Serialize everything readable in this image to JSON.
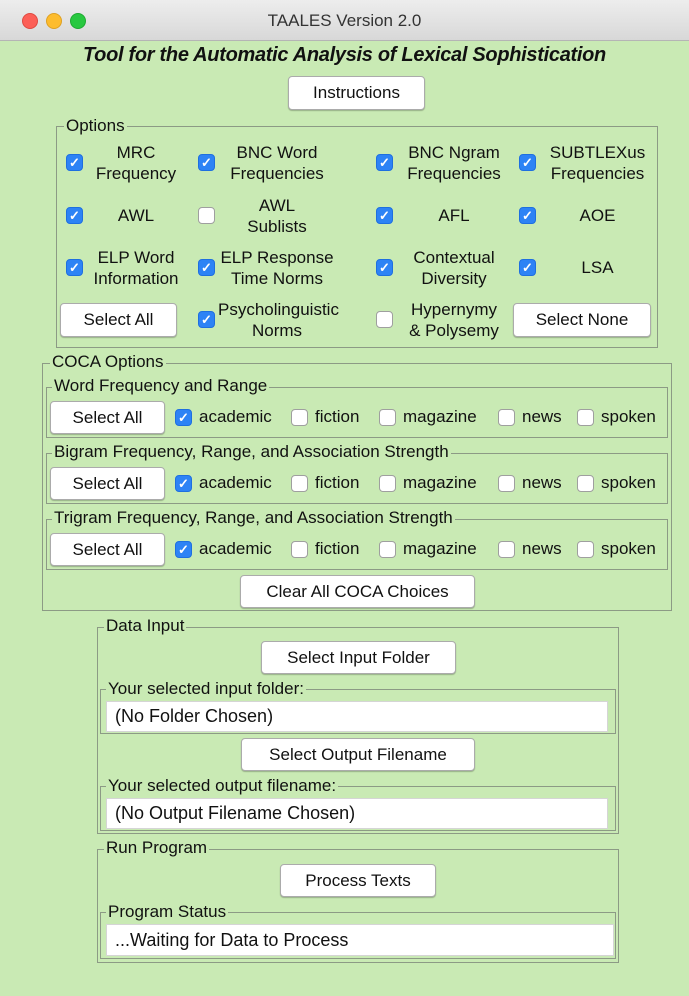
{
  "window": {
    "title": "TAALES Version 2.0"
  },
  "app_title": "Tool for the Automatic Analysis of Lexical Sophistication",
  "instructions_label": "Instructions",
  "options": {
    "legend": "Options",
    "items": [
      {
        "line1": "MRC",
        "line2": "Frequency",
        "checked": true
      },
      {
        "line1": "BNC Word",
        "line2": "Frequencies",
        "checked": true
      },
      {
        "line1": "BNC Ngram",
        "line2": "Frequencies",
        "checked": true
      },
      {
        "line1": "SUBTLEXus",
        "line2": "Frequencies",
        "checked": true
      },
      {
        "line1": "AWL",
        "line2": "",
        "checked": true
      },
      {
        "line1": "AWL",
        "line2": "Sublists",
        "checked": false
      },
      {
        "line1": "AFL",
        "line2": "",
        "checked": true
      },
      {
        "line1": "AOE",
        "line2": "",
        "checked": true
      },
      {
        "line1": "ELP Word",
        "line2": "Information",
        "checked": true
      },
      {
        "line1": "ELP Response",
        "line2": "Time Norms",
        "checked": true
      },
      {
        "line1": "Contextual",
        "line2": "Diversity",
        "checked": true
      },
      {
        "line1": "LSA",
        "line2": "",
        "checked": true
      },
      {
        "line1": "Psycholinguistic",
        "line2": "Norms",
        "checked": true
      },
      {
        "line1": "Hypernymy",
        "line2": "& Polysemy",
        "checked": false
      }
    ],
    "select_all_label": "Select All",
    "select_none_label": "Select None"
  },
  "coca": {
    "legend": "COCA Options",
    "groups": [
      {
        "legend": "Word Frequency and Range",
        "select_all_label": "Select All",
        "choices": [
          {
            "label": "academic",
            "checked": true
          },
          {
            "label": "fiction",
            "checked": false
          },
          {
            "label": "magazine",
            "checked": false
          },
          {
            "label": "news",
            "checked": false
          },
          {
            "label": "spoken",
            "checked": false
          }
        ]
      },
      {
        "legend": "Bigram Frequency, Range, and Association Strength",
        "select_all_label": "Select All",
        "choices": [
          {
            "label": "academic",
            "checked": true
          },
          {
            "label": "fiction",
            "checked": false
          },
          {
            "label": "magazine",
            "checked": false
          },
          {
            "label": "news",
            "checked": false
          },
          {
            "label": "spoken",
            "checked": false
          }
        ]
      },
      {
        "legend": "Trigram Frequency, Range, and Association Strength",
        "select_all_label": "Select All",
        "choices": [
          {
            "label": "academic",
            "checked": true
          },
          {
            "label": "fiction",
            "checked": false
          },
          {
            "label": "magazine",
            "checked": false
          },
          {
            "label": "news",
            "checked": false
          },
          {
            "label": "spoken",
            "checked": false
          }
        ]
      }
    ],
    "clear_label": "Clear All COCA Choices"
  },
  "data_input": {
    "legend": "Data Input",
    "select_folder_label": "Select Input Folder",
    "folder_legend": "Your selected input folder:",
    "folder_value": "(No Folder Chosen)",
    "select_output_label": "Select Output Filename",
    "output_legend": "Your selected output filename:",
    "output_value": "(No Output Filename Chosen)"
  },
  "run_program": {
    "legend": "Run Program",
    "process_label": "Process Texts",
    "status_legend": "Program Status",
    "status_value": "...Waiting for Data to Process"
  }
}
